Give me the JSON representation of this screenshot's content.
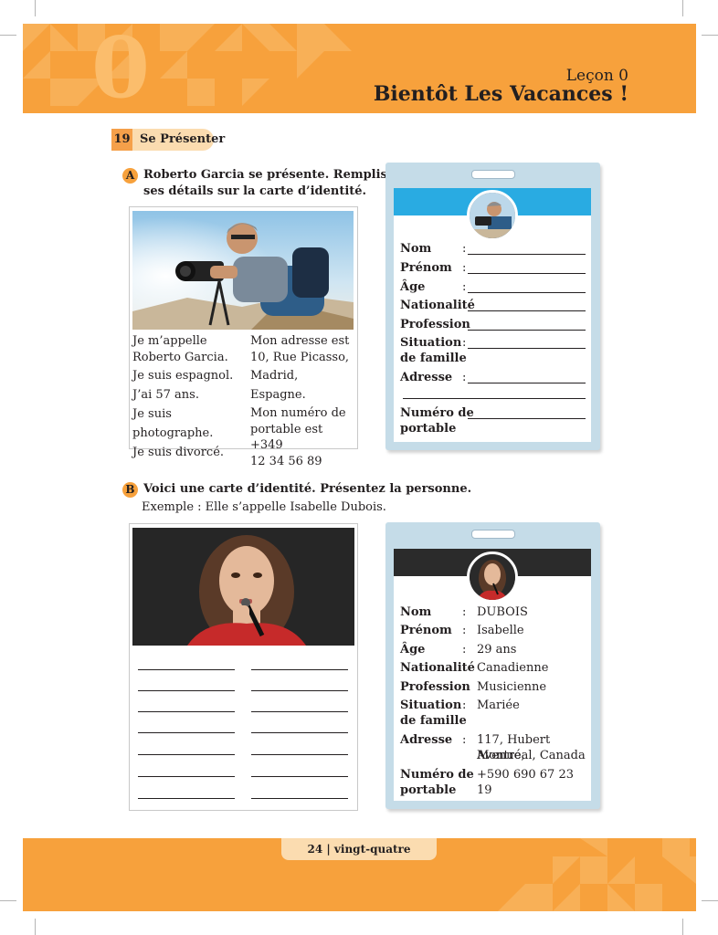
{
  "header": {
    "lesson_number": "0",
    "lesson_label": "Leçon 0",
    "lesson_title": "Bientôt Les Vacances !"
  },
  "section": {
    "number": "19",
    "title": "Se Présenter"
  },
  "part_a": {
    "letter": "A",
    "instruction_line1": "Roberto Garcia se présente. Remplissez",
    "instruction_line2": "ses détails sur la carte d’identité.",
    "text_left": [
      "Je m’appelle",
      "Roberto Garcia.",
      "Je suis espagnol.",
      "J’ai 57 ans.",
      "Je suis photographe.",
      "Je suis divorcé."
    ],
    "text_right": [
      "Mon adresse est",
      "10, Rue Picasso,",
      "Madrid, Espagne.",
      "Mon numéro de",
      "portable est  +349",
      "12 34 56 89"
    ],
    "card": {
      "header_color": "#29abe2",
      "labels": {
        "nom": "Nom",
        "prenom": "Prénom",
        "age": "Âge",
        "nationalite": "Nationalité",
        "profession": "Profession",
        "situation_1": "Situation",
        "situation_2": "de famille",
        "adresse": "Adresse",
        "numero_1": "Numéro de",
        "numero_2": "portable"
      },
      "colon": ":"
    }
  },
  "part_b": {
    "letter": "B",
    "instruction": "Voici une carte d’identité. Présentez la personne.",
    "example": "Exemple : Elle s’appelle Isabelle Dubois.",
    "card": {
      "header_color": "#2b2b2b",
      "labels": {
        "nom": "Nom",
        "prenom": "Prénom",
        "age": "Âge",
        "nationalite": "Nationalité",
        "profession": "Profession",
        "situation_1": "Situation",
        "situation_2": "de famille",
        "adresse": "Adresse",
        "numero_1": "Numéro de",
        "numero_2": "portable"
      },
      "colon": ":",
      "values": {
        "nom": "DUBOIS",
        "prenom": "Isabelle",
        "age": "29 ans",
        "nationalite": "Canadienne",
        "profession": "Musicienne",
        "situation": "Mariée",
        "adresse_1": "117, Hubert Avenue,",
        "adresse_2": "Montréal, Canada",
        "numero": "+590 690 67 23 19"
      }
    }
  },
  "footer": {
    "page": "24  |  vingt-quatre"
  },
  "colors": {
    "orange": "#f7a13c",
    "peach": "#fbdcb0",
    "card_blue": "#c5dce8"
  }
}
